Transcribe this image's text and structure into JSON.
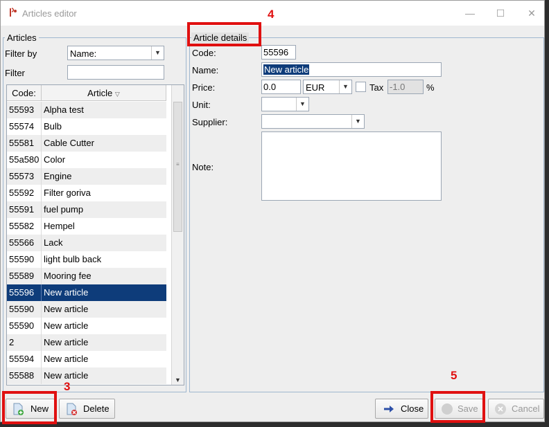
{
  "window": {
    "title": "Articles editor"
  },
  "articles_panel": {
    "legend": "Articles",
    "filter_by_label": "Filter by",
    "filter_by_value": "Name:",
    "filter_label": "Filter",
    "filter_value": "",
    "columns": [
      "Code:",
      "Article"
    ],
    "rows": [
      {
        "code": "55593",
        "name": "Alpha test"
      },
      {
        "code": "55574",
        "name": "Bulb"
      },
      {
        "code": "55581",
        "name": "Cable Cutter"
      },
      {
        "code": "55a580",
        "name": "Color"
      },
      {
        "code": "55573",
        "name": "Engine"
      },
      {
        "code": "55592",
        "name": "Filter goriva"
      },
      {
        "code": "55591",
        "name": "fuel pump"
      },
      {
        "code": "55582",
        "name": "Hempel"
      },
      {
        "code": "55566",
        "name": "Lack"
      },
      {
        "code": "55590",
        "name": "light bulb back"
      },
      {
        "code": "55589",
        "name": "Mooring fee"
      },
      {
        "code": "55596",
        "name": "New article"
      },
      {
        "code": "55590",
        "name": "New article"
      },
      {
        "code": "55590",
        "name": "New article"
      },
      {
        "code": "2",
        "name": "New article"
      },
      {
        "code": "55594",
        "name": "New article"
      },
      {
        "code": "55588",
        "name": "New article"
      }
    ],
    "selected_index": 11
  },
  "details_panel": {
    "legend": "Article details",
    "code_label": "Code:",
    "code_value": "55596",
    "name_label": "Name:",
    "name_value": "New article",
    "price_label": "Price:",
    "price_value": "0.0",
    "currency_value": "EUR",
    "tax_label": "Tax",
    "tax_value": "-1.0",
    "percent_label": "%",
    "unit_label": "Unit:",
    "unit_value": "",
    "supplier_label": "Supplier:",
    "supplier_value": "",
    "note_label": "Note:",
    "note_value": ""
  },
  "buttons": {
    "new": "New",
    "delete": "Delete",
    "close": "Close",
    "save": "Save",
    "cancel": "Cancel"
  },
  "annotations": {
    "m3": "3",
    "m4": "4",
    "m5": "5"
  },
  "colors": {
    "selection": "#0e3c7a",
    "highlight": "#e01010"
  }
}
